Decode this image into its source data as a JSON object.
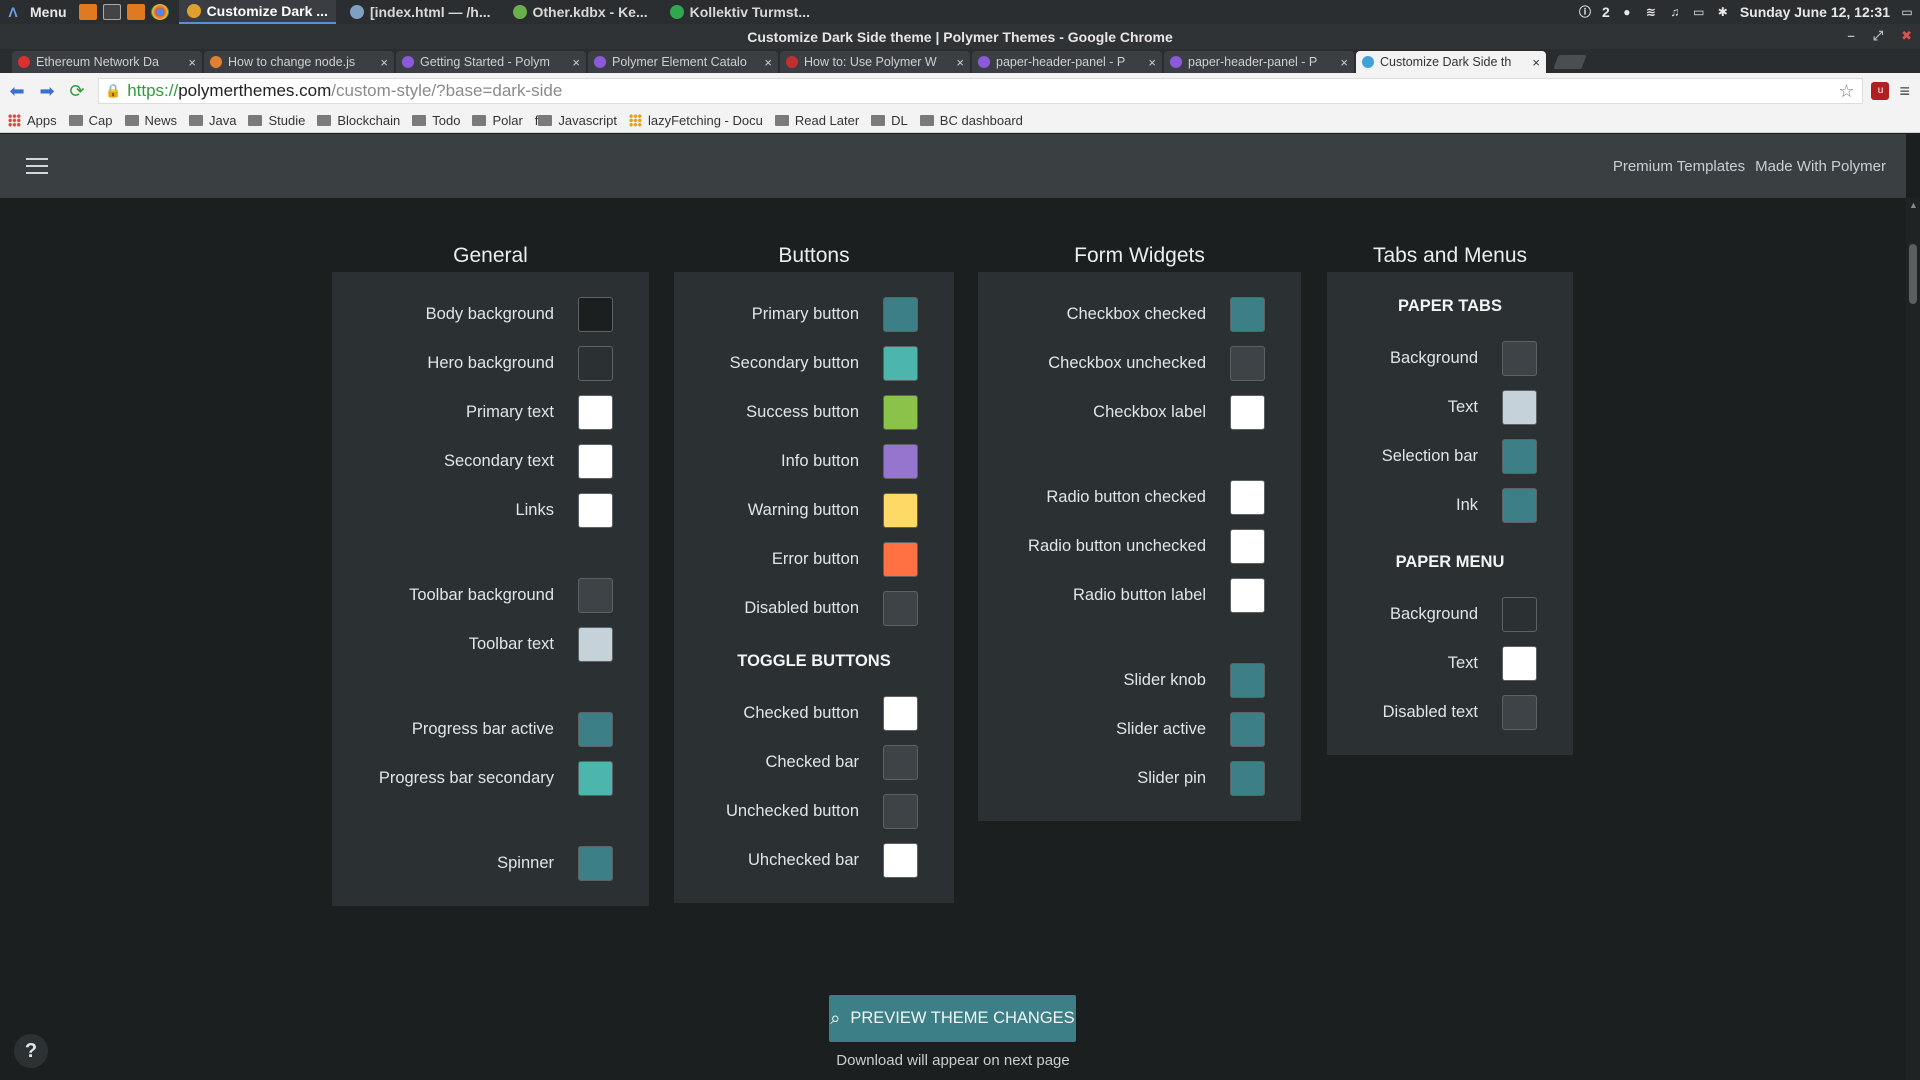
{
  "os": {
    "menu_label": "Menu",
    "tasks": [
      {
        "label": "Customize Dark ...",
        "active": true,
        "color": "#e0a030"
      },
      {
        "label": "[index.html — /h...",
        "active": false,
        "color": "#7fa0c0"
      },
      {
        "label": "Other.kdbx - Ke...",
        "active": false,
        "color": "#6ab04c"
      },
      {
        "label": "Kollektiv Turmst...",
        "active": false,
        "color": "#2fa84f"
      }
    ],
    "notif_count": "2",
    "clock": "Sunday June 12, 12:31"
  },
  "window_title": "Customize Dark Side theme | Polymer Themes - Google Chrome",
  "tabs": [
    {
      "label": "Ethereum Network Da",
      "color": "#d83030"
    },
    {
      "label": "How to change node.js",
      "color": "#e08030"
    },
    {
      "label": "Getting Started - Polym",
      "color": "#8a5ad8"
    },
    {
      "label": "Polymer Element Catalo",
      "color": "#8a5ad8"
    },
    {
      "label": "How to: Use Polymer W",
      "color": "#c03030"
    },
    {
      "label": "paper-header-panel - P",
      "color": "#8a5ad8"
    },
    {
      "label": "paper-header-panel - P",
      "color": "#8a5ad8"
    },
    {
      "label": "Customize Dark Side th",
      "color": "#40a0d8",
      "active": true
    }
  ],
  "url": {
    "scheme": "https://",
    "host": "polymerthemes.com",
    "path": "/custom-style/?base=dark-side"
  },
  "bookmarks": [
    "Apps",
    "Cap",
    "News",
    "Java",
    "Studie",
    "Blockchain",
    "Todo",
    "Polar",
    "Javascript",
    "lazyFetching - Docu",
    "Read Later",
    "DL",
    "BC dashboard"
  ],
  "page": {
    "top_links": [
      "Premium Templates",
      "Made With Polymer"
    ],
    "columns": {
      "general": {
        "title": "General",
        "rows": [
          {
            "label": "Body background",
            "color": "#1c1f20"
          },
          {
            "label": "Hero background",
            "color": "#2b3032"
          },
          {
            "label": "Primary text",
            "color": "#ffffff"
          },
          {
            "label": "Secondary text",
            "color": "#ffffff"
          },
          {
            "label": "Links",
            "color": "#ffffff"
          },
          {
            "label": "Toolbar background",
            "color": "#3d4346"
          },
          {
            "label": "Toolbar text",
            "color": "#c5d2d9"
          },
          {
            "label": "Progress bar active",
            "color": "#3d7f86"
          },
          {
            "label": "Progress bar secondary",
            "color": "#4db6ac"
          },
          {
            "label": "Spinner",
            "color": "#3d7f86"
          }
        ]
      },
      "buttons": {
        "title": "Buttons",
        "rows": [
          {
            "label": "Primary button",
            "color": "#3d7f86"
          },
          {
            "label": "Secondary button",
            "color": "#4db6ac"
          },
          {
            "label": "Success button",
            "color": "#8bc34a"
          },
          {
            "label": "Info button",
            "color": "#9575cd"
          },
          {
            "label": "Warning button",
            "color": "#ffd966"
          },
          {
            "label": "Error button",
            "color": "#ff7043"
          },
          {
            "label": "Disabled button",
            "color": "#3d4346"
          }
        ],
        "toggle_title": "TOGGLE BUTTONS",
        "toggle_rows": [
          {
            "label": "Checked button",
            "color": "#ffffff"
          },
          {
            "label": "Checked bar",
            "color": "#3d4346"
          },
          {
            "label": "Unchecked button",
            "color": "#3d4346"
          },
          {
            "label": "Uhchecked bar",
            "color": "#ffffff"
          }
        ]
      },
      "forms": {
        "title": "Form Widgets",
        "rows": [
          {
            "label": "Checkbox checked",
            "color": "#3d7f86"
          },
          {
            "label": "Checkbox unchecked",
            "color": "#3d4346"
          },
          {
            "label": "Checkbox label",
            "color": "#ffffff"
          },
          {
            "label": "Radio button checked",
            "color": "#ffffff"
          },
          {
            "label": "Radio button unchecked",
            "color": "#ffffff"
          },
          {
            "label": "Radio button label",
            "color": "#ffffff"
          },
          {
            "label": "Slider knob",
            "color": "#3d7f86"
          },
          {
            "label": "Slider active",
            "color": "#3d7f86"
          },
          {
            "label": "Slider pin",
            "color": "#3d7f86"
          }
        ]
      },
      "tabs_menus": {
        "title": "Tabs and Menus",
        "tabs_title": "PAPER TABS",
        "tabs_rows": [
          {
            "label": "Background",
            "color": "#3d4346"
          },
          {
            "label": "Text",
            "color": "#c5d2d9"
          },
          {
            "label": "Selection bar",
            "color": "#3d7f86"
          },
          {
            "label": "Ink",
            "color": "#3d7f86"
          }
        ],
        "menu_title": "PAPER MENU",
        "menu_rows": [
          {
            "label": "Background",
            "color": "#2b3032"
          },
          {
            "label": "Text",
            "color": "#ffffff"
          },
          {
            "label": "Disabled text",
            "color": "#3d4346"
          }
        ]
      }
    },
    "preview_button": "PREVIEW THEME CHANGES",
    "download_note": "Download will appear on next page",
    "help_label": "?"
  }
}
